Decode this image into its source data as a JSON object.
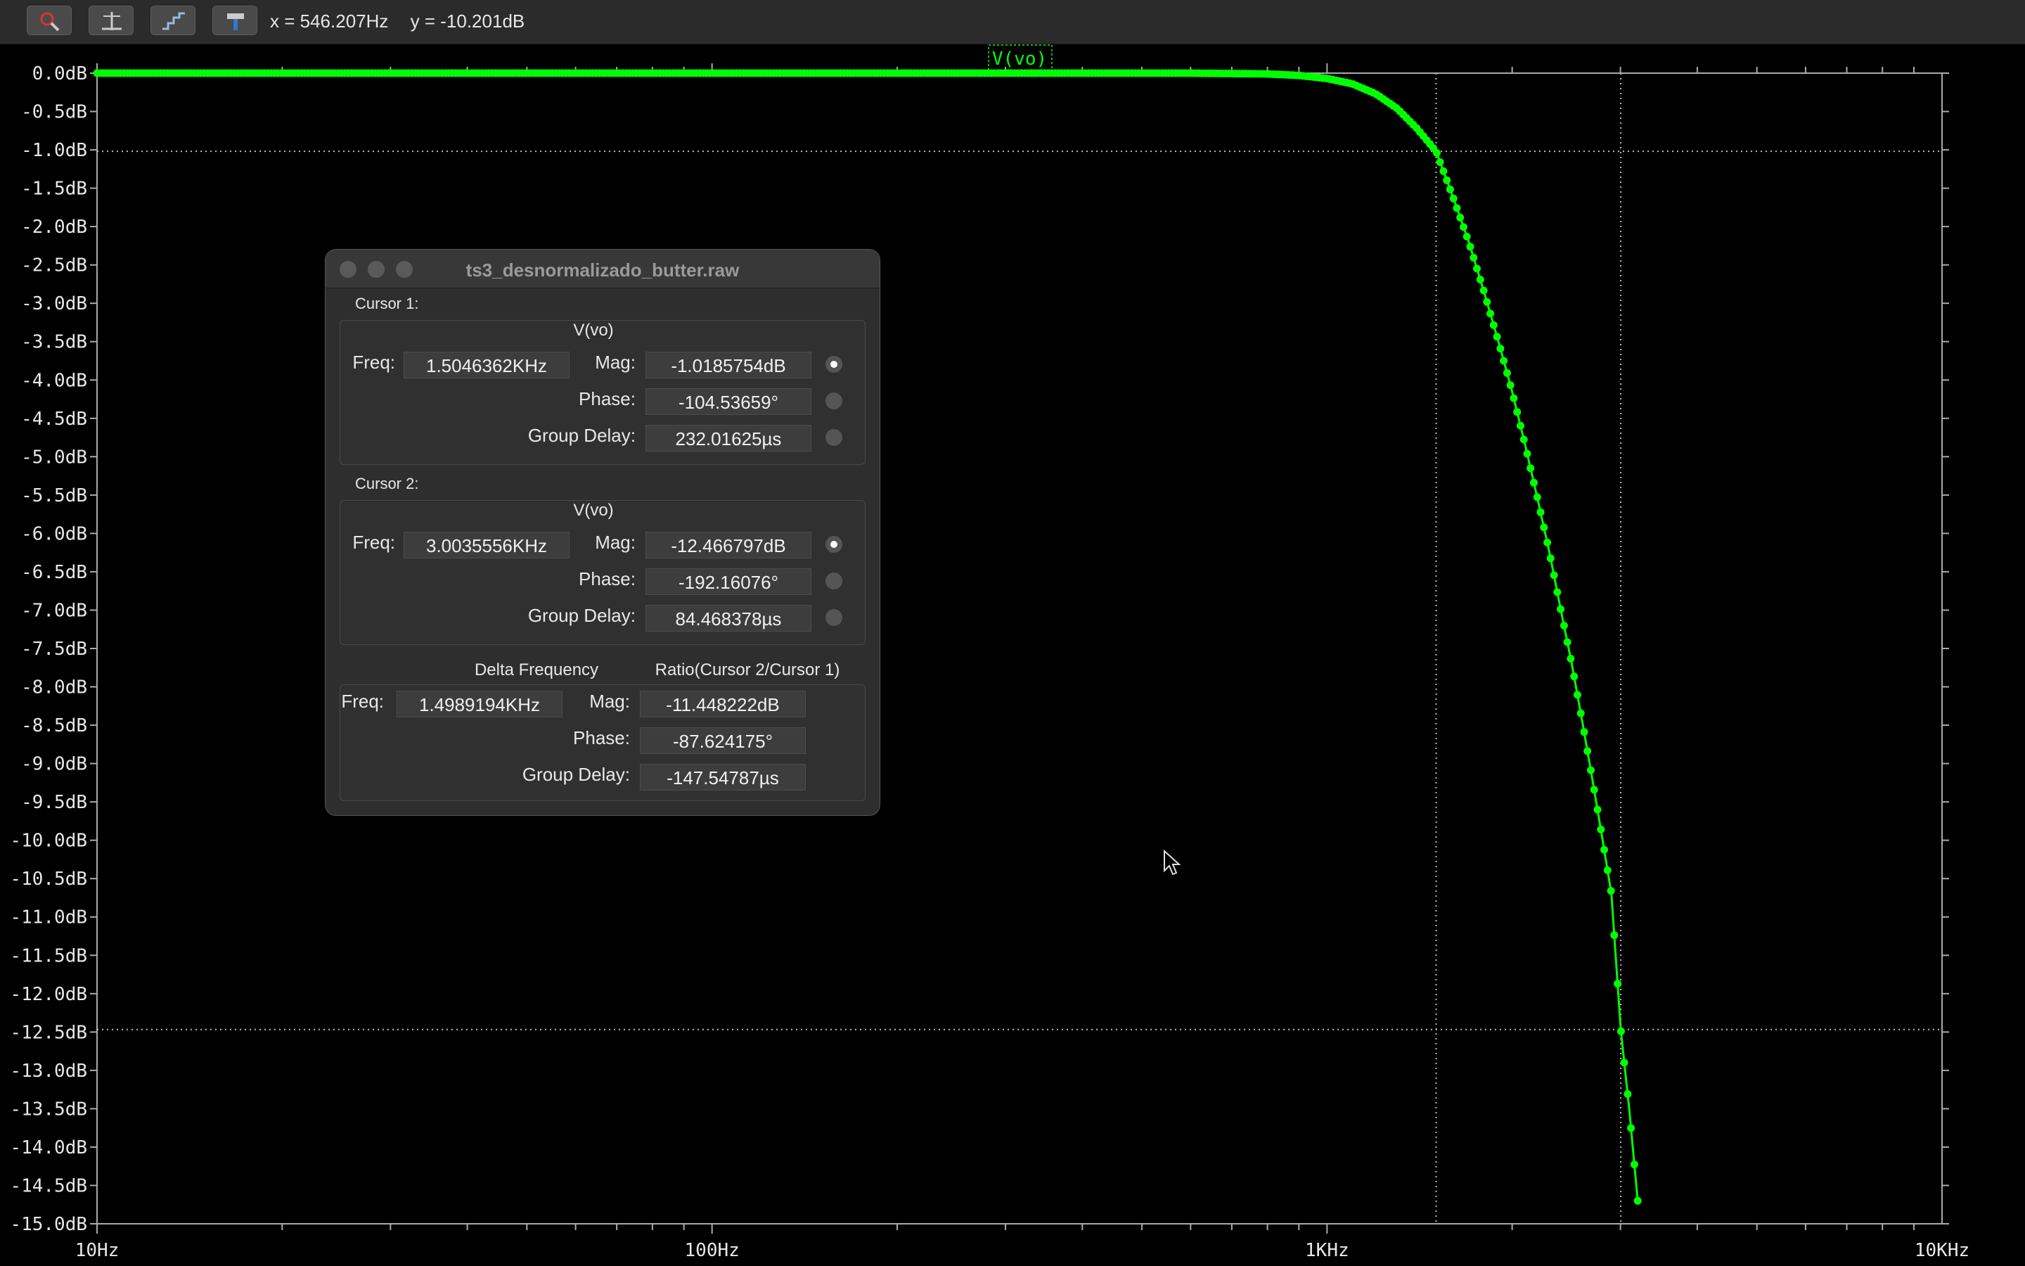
{
  "toolbar": {
    "buttons": [
      "autorange-icon",
      "cursor-axis-icon",
      "step-icon",
      "hammer-icon"
    ],
    "x_readout": "x = 546.207Hz",
    "y_readout": "y = -10.201dB"
  },
  "plot": {
    "trace_label": "V(vo)",
    "trace_color": "#00ff00",
    "grid_color": "#aaaaaa",
    "cursor1_freq_hz": 1504.6362,
    "cursor1_mag_db": -1.0185754,
    "cursor2_freq_hz": 3003.5556,
    "cursor2_mag_db": -12.466797
  },
  "chart_data": {
    "type": "line",
    "title": "V(vo)",
    "xlabel": "",
    "ylabel": "",
    "x_scale": "log",
    "xlim": [
      10,
      10000
    ],
    "ylim": [
      -15,
      0
    ],
    "x_ticks": [
      "10Hz",
      "100Hz",
      "1KHz",
      "10KHz"
    ],
    "y_ticks": [
      "0.0dB",
      "-0.5dB",
      "-1.0dB",
      "-1.5dB",
      "-2.0dB",
      "-2.5dB",
      "-3.0dB",
      "-3.5dB",
      "-4.0dB",
      "-4.5dB",
      "-5.0dB",
      "-5.5dB",
      "-6.0dB",
      "-6.5dB",
      "-7.0dB",
      "-7.5dB",
      "-8.0dB",
      "-8.5dB",
      "-9.0dB",
      "-9.5dB",
      "-10.0dB",
      "-10.5dB",
      "-11.0dB",
      "-11.5dB",
      "-12.0dB",
      "-12.5dB",
      "-13.0dB",
      "-13.5dB",
      "-14.0dB",
      "-14.5dB",
      "-15.0dB"
    ],
    "series": [
      {
        "name": "V(vo)",
        "x": [
          10,
          100,
          300,
          600,
          800,
          900,
          1000,
          1100,
          1200,
          1300,
          1400,
          1504.6,
          1600,
          1700,
          1800,
          1900,
          2000,
          2100,
          2200,
          2300,
          2400,
          2500,
          2600,
          2700,
          2800,
          2900,
          3003.6,
          3100,
          3200
        ],
        "values": [
          0,
          0,
          0,
          0,
          -0.01,
          -0.03,
          -0.07,
          -0.14,
          -0.27,
          -0.46,
          -0.72,
          -1.02,
          -1.6,
          -2.2,
          -2.85,
          -3.5,
          -4.15,
          -4.85,
          -5.55,
          -6.25,
          -7.0,
          -7.7,
          -8.45,
          -9.2,
          -9.95,
          -10.7,
          -12.47,
          -13.5,
          -14.7
        ]
      }
    ],
    "grid": false,
    "cursors": [
      {
        "x": 1504.6362,
        "y": -1.0185754
      },
      {
        "x": 3003.5556,
        "y": -12.466797
      }
    ]
  },
  "cursor_window": {
    "title": "ts3_desnormalizado_butter.raw",
    "cursor1": {
      "label": "Cursor 1:",
      "trace": "V(vo)",
      "freq_label": "Freq:",
      "freq": "1.5046362KHz",
      "mag_label": "Mag:",
      "mag": "-1.0185754dB",
      "phase_label": "Phase:",
      "phase": "-104.53659°",
      "gd_label": "Group Delay:",
      "gd": "232.01625µs"
    },
    "cursor2": {
      "label": "Cursor 2:",
      "trace": "V(vo)",
      "freq_label": "Freq:",
      "freq": "3.0035556KHz",
      "mag_label": "Mag:",
      "mag": "-12.466797dB",
      "phase_label": "Phase:",
      "phase": "-192.16076°",
      "gd_label": "Group Delay:",
      "gd": "84.468378µs"
    },
    "delta": {
      "delta_header": "Delta Frequency",
      "ratio_header": "Ratio(Cursor 2/Cursor 1)",
      "freq_label": "Freq:",
      "freq": "1.4989194KHz",
      "mag_label": "Mag:",
      "mag": "-11.448222dB",
      "phase_label": "Phase:",
      "phase": "-87.624175°",
      "gd_label": "Group Delay:",
      "gd": "-147.54787µs"
    }
  }
}
